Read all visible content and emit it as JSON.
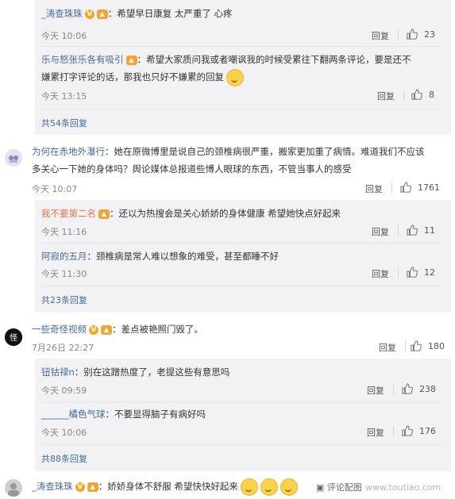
{
  "colors": {
    "username_orange": "#eb7350",
    "username_blue": "#466a9b",
    "link_blue": "#466a9b",
    "reply_bg": "#f2f2f5"
  },
  "thread1": {
    "c1": {
      "name": "_涛查珠珠",
      "text": "：希望早日康复 太严重了 心疼",
      "time": "今天 10:06",
      "reply": "回复",
      "likes": "23"
    },
    "c2": {
      "name": "乐与怒张乐各有吸引",
      "text_line1": "：希望大家质问我或者嘲讽我的时候受累往下翻两条评论，要是还不",
      "text_line2": "嫌累打字评论的话，那我也只好不嫌累的回复",
      "time": "今天 13:15",
      "reply": "回复",
      "likes": "8"
    },
    "more": "共54条回复"
  },
  "thread2": {
    "main": {
      "name": "为何在赤地外瀑行",
      "text_line1": "：她在原微博里是说自己的颈椎病很严重，搬家更加重了病情。难道我们不应该",
      "text_line2": "多关心一下她的身体吗？舆论媒体总报道些博人眼球的东西，不管当事人的感受",
      "time": "今天 10:07",
      "reply": "回复",
      "likes": "1761"
    },
    "r1": {
      "name": "我不要第二名",
      "text": "：还以为热搜会是关心娇娇的身体健康 希望她快点好起来",
      "time": "今天 11:16",
      "reply": "回复",
      "likes": "11"
    },
    "r2": {
      "name": "阿寂的五月",
      "text": "：颈椎病是常人难以想象的难受，甚至都睡不好",
      "time": "今天 11:30",
      "reply": "回复",
      "likes": "12"
    },
    "more": "共23条回复"
  },
  "thread3": {
    "main": {
      "name": "一些奇怪视频",
      "text": "：差点被艳照门毁了。",
      "time": "7月26日 22:27",
      "reply": "回复",
      "likes": "180"
    },
    "r1": {
      "name": "钮钴禄n",
      "text": "：别在这蹭热度了，老提这些有意思吗",
      "time": "今天 09:59",
      "reply": "回复",
      "likes": "238"
    },
    "r2": {
      "name": "______橘色气球",
      "text": "：不要显得脑子有病好吗",
      "time": "今天 10:06",
      "reply": "回复",
      "likes": "176"
    },
    "more": "共88条回复"
  },
  "thread4": {
    "main": {
      "name": "_涛查珠珠",
      "text": "：娇娇身体不舒服 希望快快好起来"
    },
    "watermark": "www.toutiao.com",
    "report": "评论配图"
  },
  "icons": {
    "thumb": "thumbs-up-icon",
    "verified": "verified-badge-icon",
    "level": "level-badge-icon",
    "emoji": "smile-emoji-icon"
  }
}
